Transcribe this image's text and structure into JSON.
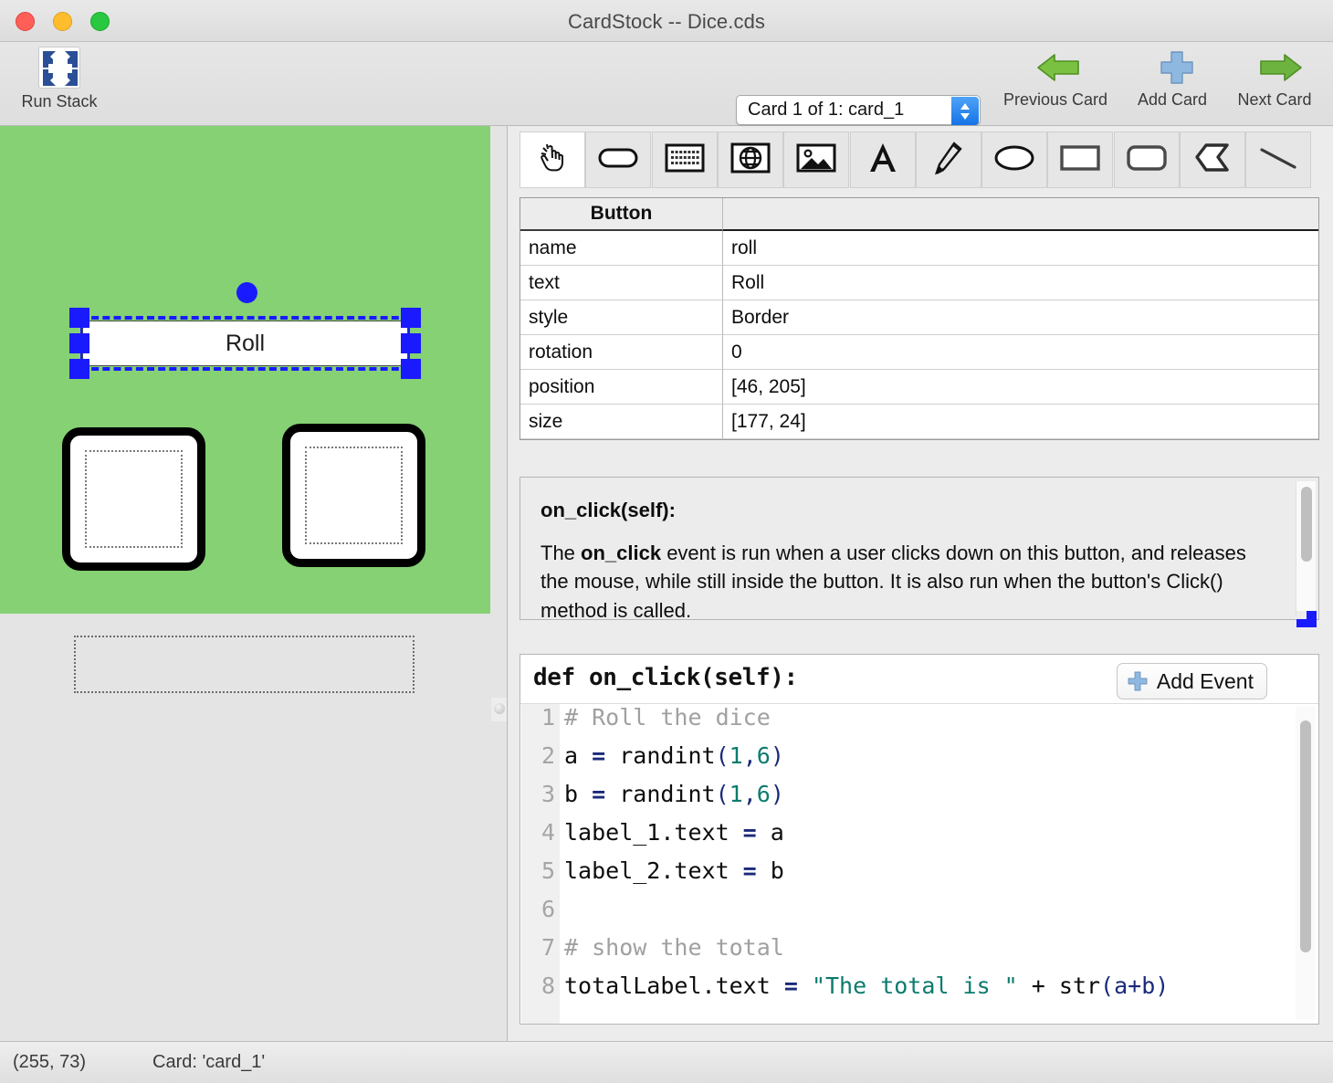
{
  "window": {
    "title": "CardStock -- Dice.cds",
    "traffic_lights": [
      "close-button",
      "minimize-button",
      "maximize-button"
    ]
  },
  "toolbar": {
    "run_stack": {
      "label": "Run Stack",
      "icon": "run-stack-icon"
    },
    "card_selector": {
      "value": "Card 1 of 1: card_1"
    },
    "previous_card": {
      "label": "Previous Card",
      "icon": "left-arrow-icon"
    },
    "add_card": {
      "label": "Add Card",
      "icon": "plus-icon"
    },
    "next_card": {
      "label": "Next Card",
      "icon": "right-arrow-icon"
    }
  },
  "canvas": {
    "background_color": "#85d174",
    "button": {
      "text": "Roll",
      "selected": true
    },
    "die_1": {
      "name": "die-1"
    },
    "die_2": {
      "name": "die-2"
    },
    "total_label": {
      "name": "total-label-placeholder"
    }
  },
  "palette": {
    "tools": [
      {
        "name": "hand-tool",
        "icon": "hand-pointer-icon",
        "active": true
      },
      {
        "name": "button-tool",
        "icon": "rounded-pill-icon",
        "active": false
      },
      {
        "name": "text-field-tool",
        "icon": "text-field-icon",
        "active": false
      },
      {
        "name": "web-view-tool",
        "icon": "globe-icon",
        "active": false
      },
      {
        "name": "image-tool",
        "icon": "image-icon",
        "active": false
      },
      {
        "name": "text-label-tool",
        "icon": "letter-a-icon",
        "active": false
      },
      {
        "name": "pen-tool",
        "icon": "pencil-icon",
        "active": false
      },
      {
        "name": "oval-tool",
        "icon": "oval-icon",
        "active": false
      },
      {
        "name": "rect-tool",
        "icon": "rectangle-icon",
        "active": false
      },
      {
        "name": "round-rect-tool",
        "icon": "rounded-rect-icon",
        "active": false
      },
      {
        "name": "polygon-tool",
        "icon": "polygon-icon",
        "active": false
      },
      {
        "name": "line-tool",
        "icon": "line-icon",
        "active": false
      }
    ]
  },
  "properties": {
    "header": {
      "type": "Button",
      "value": ""
    },
    "rows": [
      {
        "key": "name",
        "value": "roll"
      },
      {
        "key": "text",
        "value": "Roll"
      },
      {
        "key": "style",
        "value": "Border"
      },
      {
        "key": "rotation",
        "value": "0"
      },
      {
        "key": "position",
        "value": "[46, 205]"
      },
      {
        "key": "size",
        "value": "[177, 24]"
      }
    ]
  },
  "documentation": {
    "signature": "on_click(self):",
    "paragraph_pre": "The ",
    "paragraph_bold": "on_click",
    "paragraph_post": " event is run when a user clicks down on this button, and releases the mouse, while still inside the button. It is also run when the button's Click() method is called."
  },
  "editor": {
    "def_line": "def on_click(self):",
    "add_event_label": "Add Event",
    "lines": [
      {
        "num": "1",
        "segments": [
          {
            "t": "# Roll the dice",
            "c": "tok-com"
          }
        ]
      },
      {
        "num": "2",
        "segments": [
          {
            "t": "a ",
            "c": ""
          },
          {
            "t": "=",
            "c": "tok-op"
          },
          {
            "t": " randint",
            "c": ""
          },
          {
            "t": "(",
            "c": "tok-par"
          },
          {
            "t": "1",
            "c": "tok-num"
          },
          {
            "t": ",",
            "c": "tok-par"
          },
          {
            "t": "6",
            "c": "tok-num"
          },
          {
            "t": ")",
            "c": "tok-par"
          }
        ]
      },
      {
        "num": "3",
        "segments": [
          {
            "t": "b ",
            "c": ""
          },
          {
            "t": "=",
            "c": "tok-op"
          },
          {
            "t": " randint",
            "c": ""
          },
          {
            "t": "(",
            "c": "tok-par"
          },
          {
            "t": "1",
            "c": "tok-num"
          },
          {
            "t": ",",
            "c": "tok-par"
          },
          {
            "t": "6",
            "c": "tok-num"
          },
          {
            "t": ")",
            "c": "tok-par"
          }
        ]
      },
      {
        "num": "4",
        "segments": [
          {
            "t": "label_1.text ",
            "c": ""
          },
          {
            "t": "=",
            "c": "tok-op"
          },
          {
            "t": " a",
            "c": ""
          }
        ]
      },
      {
        "num": "5",
        "segments": [
          {
            "t": "label_2.text ",
            "c": ""
          },
          {
            "t": "=",
            "c": "tok-op"
          },
          {
            "t": " b",
            "c": ""
          }
        ]
      },
      {
        "num": "6",
        "segments": [
          {
            "t": "",
            "c": ""
          }
        ]
      },
      {
        "num": "7",
        "segments": [
          {
            "t": "# show the total",
            "c": "tok-com"
          }
        ]
      },
      {
        "num": "8",
        "segments": [
          {
            "t": "totalLabel.text ",
            "c": ""
          },
          {
            "t": "=",
            "c": "tok-op"
          },
          {
            "t": " ",
            "c": ""
          },
          {
            "t": "\"The total is \"",
            "c": "tok-str"
          },
          {
            "t": " + str",
            "c": ""
          },
          {
            "t": "(a+b)",
            "c": "tok-par"
          }
        ]
      }
    ]
  },
  "status": {
    "coordinates": "(255, 73)",
    "card": "Card: 'card_1'"
  }
}
